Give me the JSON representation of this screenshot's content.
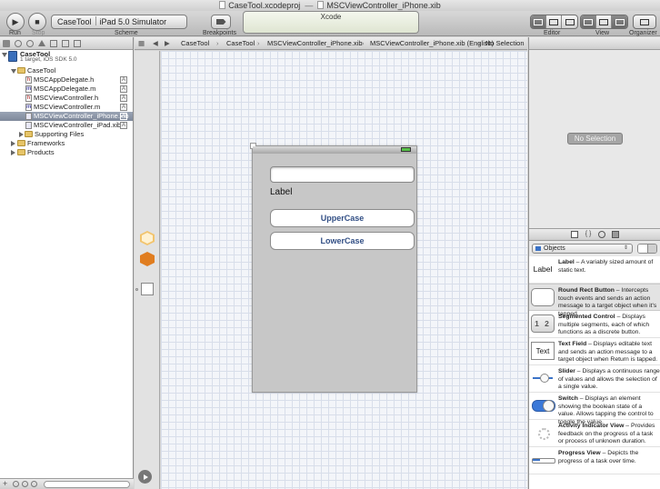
{
  "window": {
    "project_file": "CaseTool.xcodeproj",
    "separator": "—",
    "current_file": "MSCViewController_iPhone.xib"
  },
  "toolbar": {
    "run_label": "Run",
    "stop_label": "Stop",
    "scheme_target": "CaseTool",
    "scheme_destination": "iPad 5.0 Simulator",
    "scheme_label": "Scheme",
    "breakpoints_label": "Breakpoints",
    "activity_title": "Xcode",
    "editor_label": "Editor",
    "view_label": "View",
    "organizer_label": "Organizer"
  },
  "navigator": {
    "project": {
      "name": "CaseTool",
      "subtitle": "1 target, iOS SDK 5.0"
    },
    "items": [
      {
        "label": "CaseTool",
        "type": "folder",
        "level": 1,
        "expanded": true
      },
      {
        "label": "MSCAppDelegate.h",
        "type": "h",
        "level": 2
      },
      {
        "label": "MSCAppDelegate.m",
        "type": "m",
        "level": 2
      },
      {
        "label": "MSCViewController.h",
        "type": "h",
        "level": 2
      },
      {
        "label": "MSCViewController.m",
        "type": "m",
        "level": 2
      },
      {
        "label": "MSCViewController_iPhone.xib",
        "type": "xib",
        "level": 2,
        "selected": true
      },
      {
        "label": "MSCViewController_iPad.xib",
        "type": "xib",
        "level": 2
      },
      {
        "label": "Supporting Files",
        "type": "folder",
        "level": 2,
        "expanded": false
      },
      {
        "label": "Frameworks",
        "type": "folder",
        "level": 1,
        "expanded": false
      },
      {
        "label": "Products",
        "type": "folder",
        "level": 1,
        "expanded": false
      }
    ],
    "badge": "A"
  },
  "jumpbar": {
    "crumbs": [
      "CaseTool",
      "CaseTool",
      "MSCViewController_iPhone.xib",
      "MSCViewController_iPhone.xib (English)",
      "No Selection"
    ]
  },
  "canvas": {
    "label_text": "Label",
    "button1": "UpperCase",
    "button2": "LowerCase"
  },
  "inspector": {
    "no_selection": "No Selection"
  },
  "library": {
    "tabs": [
      "document-icon",
      "braces-icon",
      "object-icon",
      "media-icon"
    ],
    "filter": "Objects",
    "items": [
      {
        "thumb": "Label",
        "name": "Label",
        "desc": " – A variably sized amount of static text."
      },
      {
        "thumb": "",
        "name": "Round Rect Button",
        "desc": " – Intercepts touch events and sends an action message to a target object when it's tapped."
      },
      {
        "thumb": "1 2",
        "name": "Segmented Control",
        "desc": " – Displays multiple segments, each of which functions as a discrete button."
      },
      {
        "thumb": "Text",
        "name": "Text Field",
        "desc": " – Displays editable text and sends an action message to a target object when Return is tapped."
      },
      {
        "thumb": "",
        "name": "Slider",
        "desc": " – Displays a continuous range of values and allows the selection of a single value."
      },
      {
        "thumb": "",
        "name": "Switch",
        "desc": " – Displays an element showing the boolean state of a value. Allows tapping the control to toggle the value."
      },
      {
        "thumb": "",
        "name": "Activity Indicator View",
        "desc": " – Provides feedback on the progress of a task or process of unknown duration."
      },
      {
        "thumb": "",
        "name": "Progress View",
        "desc": " – Depicts the progress of a task over time."
      }
    ]
  },
  "colors": {
    "selection": "#8590a3",
    "button_text": "#324f85",
    "canvas_grid": "#d8deea"
  }
}
